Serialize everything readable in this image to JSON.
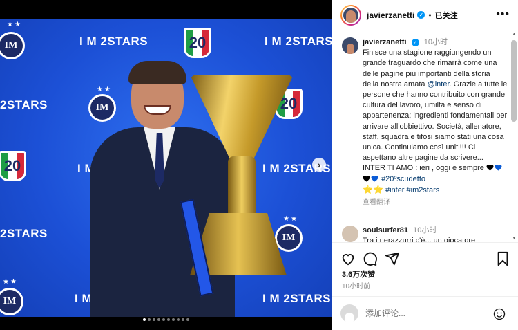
{
  "photo": {
    "wall_texts": [
      "I M 2STARS",
      "I M 2STARS",
      "2STARS",
      "I M 2S",
      "I M 2STARS",
      "2STARS",
      "I M 2STARS",
      "I M 2STARS"
    ],
    "badge_number": "20",
    "logo_text": "IM",
    "stars": "★★",
    "next_arrow": "›",
    "carousel_count": 10,
    "carousel_active": 0
  },
  "header": {
    "username": "javierzanetti",
    "verified_mark": "✓",
    "separator": "•",
    "follow_label": "已关注",
    "more_label": "•••"
  },
  "caption": {
    "username": "javierzanetti",
    "time": "10小时",
    "text_1": "Finisce una stagione raggiungendo un grande traguardo che rimarrà come una delle pagine più importanti della storia della nostra amata ",
    "mention": "@inter",
    "text_2": ". Grazie a tutte le persone che hanno contribuito con grande cultura del lavoro, umiltà e senso di appartenenza; ingredienti fondamentali per arrivare all'obbiettivo. Società, allenatore, staff, squadra e tifosi siamo stati una cosa unica. Continuiamo così uniti!!! Ci aspettano altre pagine da scrivere... INTER TI AMO : ieri , oggi e sempre ",
    "hearts": [
      "#000000",
      "#0a5bd6",
      "#000000",
      "#0a5bd6"
    ],
    "hashtag_1": "#20ºscudetto",
    "stars": "⭐⭐",
    "hashtag_2": "#inter",
    "hashtag_3": "#im2stars",
    "translate": "查看翻译"
  },
  "comment2": {
    "username": "soulsurfer81",
    "time": "10小时",
    "text": "Tra i nerazzurri c'è... un giocatore"
  },
  "actions": {
    "likes": "3.6万次赞",
    "ago": "10小时前"
  },
  "compose": {
    "placeholder": "添加评论..."
  },
  "scrollbar": {
    "up": "▲",
    "down": "▼"
  }
}
